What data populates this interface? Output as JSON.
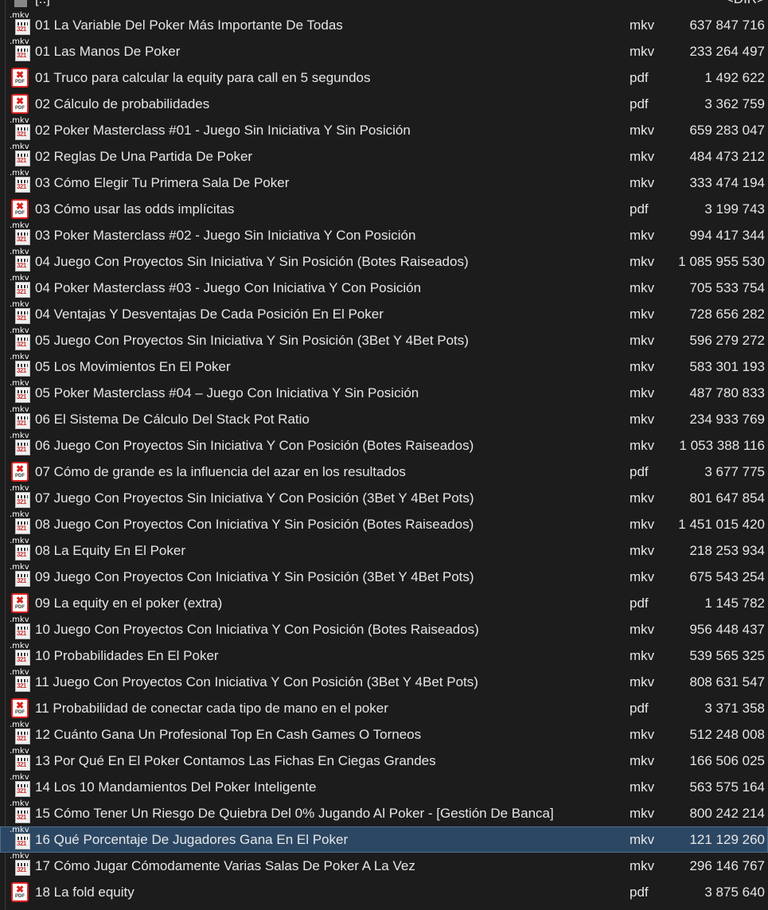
{
  "parent": {
    "name": "[..]",
    "size": "<DIR>"
  },
  "files": [
    {
      "name": "01 La Variable Del Poker Más Importante De Todas",
      "ext": "mkv",
      "size": "637 847 716"
    },
    {
      "name": "01 Las Manos De Poker",
      "ext": "mkv",
      "size": "233 264 497"
    },
    {
      "name": "01 Truco para calcular la equity para call en 5 segundos",
      "ext": "pdf",
      "size": "1 492 622"
    },
    {
      "name": "02 Cálculo de probabilidades",
      "ext": "pdf",
      "size": "3 362 759"
    },
    {
      "name": "02 Poker Masterclass #01 - Juego Sin Iniciativa Y Sin Posición",
      "ext": "mkv",
      "size": "659 283 047"
    },
    {
      "name": "02 Reglas De Una Partida De Poker",
      "ext": "mkv",
      "size": "484 473 212"
    },
    {
      "name": "03 Cómo Elegir Tu Primera Sala De Poker",
      "ext": "mkv",
      "size": "333 474 194"
    },
    {
      "name": "03 Cómo usar las odds implícitas",
      "ext": "pdf",
      "size": "3 199 743"
    },
    {
      "name": "03 Poker Masterclass #02 - Juego Sin Iniciativa Y Con Posición",
      "ext": "mkv",
      "size": "994 417 344"
    },
    {
      "name": "04 Juego Con Proyectos Sin Iniciativa Y Sin Posición (Botes Raiseados)",
      "ext": "mkv",
      "size": "1 085 955 530"
    },
    {
      "name": "04 Poker Masterclass #03 - Juego Con Iniciativa Y Con Posición",
      "ext": "mkv",
      "size": "705 533 754"
    },
    {
      "name": "04 Ventajas Y Desventajas De Cada Posición En El Poker",
      "ext": "mkv",
      "size": "728 656 282"
    },
    {
      "name": "05 Juego Con Proyectos Sin Iniciativa Y Sin Posición (3Bet Y 4Bet Pots)",
      "ext": "mkv",
      "size": "596 279 272"
    },
    {
      "name": "05 Los Movimientos En El Poker",
      "ext": "mkv",
      "size": "583 301 193"
    },
    {
      "name": "05 Poker Masterclass #04 – Juego Con Iniciativa Y Sin Posición",
      "ext": "mkv",
      "size": "487 780 833"
    },
    {
      "name": "06 El Sistema De Cálculo Del Stack Pot Ratio",
      "ext": "mkv",
      "size": "234 933 769"
    },
    {
      "name": "06 Juego Con Proyectos Sin Iniciativa Y Con Posición (Botes Raiseados)",
      "ext": "mkv",
      "size": "1 053 388 116"
    },
    {
      "name": "07 Cómo de grande es la influencia del azar en los resultados",
      "ext": "pdf",
      "size": "3 677 775"
    },
    {
      "name": "07 Juego Con Proyectos Sin Iniciativa Y Con Posición (3Bet Y 4Bet Pots)",
      "ext": "mkv",
      "size": "801 647 854"
    },
    {
      "name": "08 Juego Con Proyectos Con Iniciativa Y Sin Posición (Botes Raiseados)",
      "ext": "mkv",
      "size": "1 451 015 420"
    },
    {
      "name": "08 La Equity En El Poker",
      "ext": "mkv",
      "size": "218 253 934"
    },
    {
      "name": "09 Juego Con Proyectos Con Iniciativa Y Sin Posición (3Bet Y 4Bet Pots)",
      "ext": "mkv",
      "size": "675 543 254"
    },
    {
      "name": "09 La equity en el poker (extra)",
      "ext": "pdf",
      "size": "1 145 782"
    },
    {
      "name": "10 Juego Con Proyectos Con Iniciativa Y Con Posición (Botes Raiseados)",
      "ext": "mkv",
      "size": "956 448 437"
    },
    {
      "name": "10 Probabilidades En El Poker",
      "ext": "mkv",
      "size": "539 565 325"
    },
    {
      "name": "11 Juego Con Proyectos Con Iniciativa Y Con Posición (3Bet Y 4Bet Pots)",
      "ext": "mkv",
      "size": "808 631 547"
    },
    {
      "name": "11 Probabilidad de conectar cada tipo de mano en el poker",
      "ext": "pdf",
      "size": "3 371 358"
    },
    {
      "name": "12 Cuánto Gana Un Profesional Top En Cash Games O Torneos",
      "ext": "mkv",
      "size": "512 248 008"
    },
    {
      "name": "13 Por Qué En El Poker Contamos Las Fichas En Ciegas Grandes",
      "ext": "mkv",
      "size": "166 506 025"
    },
    {
      "name": "14 Los 10 Mandamientos Del Poker Inteligente",
      "ext": "mkv",
      "size": "563 575 164"
    },
    {
      "name": "15 Cómo Tener Un Riesgo De Quiebra Del 0% Jugando Al Poker  - [Gestión De Banca]",
      "ext": "mkv",
      "size": "800 242 214"
    },
    {
      "name": "16 Qué Porcentaje De Jugadores Gana En El Poker",
      "ext": "mkv",
      "size": "121 129 260",
      "selected": true
    },
    {
      "name": "17  Cómo Jugar Cómodamente Varias Salas De Poker A La Vez",
      "ext": "mkv",
      "size": "296 146 767"
    },
    {
      "name": "18 La fold equity",
      "ext": "pdf",
      "size": "3 875 640"
    }
  ],
  "icons": {
    "mkv": "video-file-icon",
    "pdf": "pdf-file-icon",
    "mkv_label": ".mkv",
    "mkv_digits": "321",
    "pdf_label": "PDF"
  },
  "colors": {
    "background": "#1c1c1c",
    "selection": "#2c4763",
    "text": "#e6e6e6"
  }
}
